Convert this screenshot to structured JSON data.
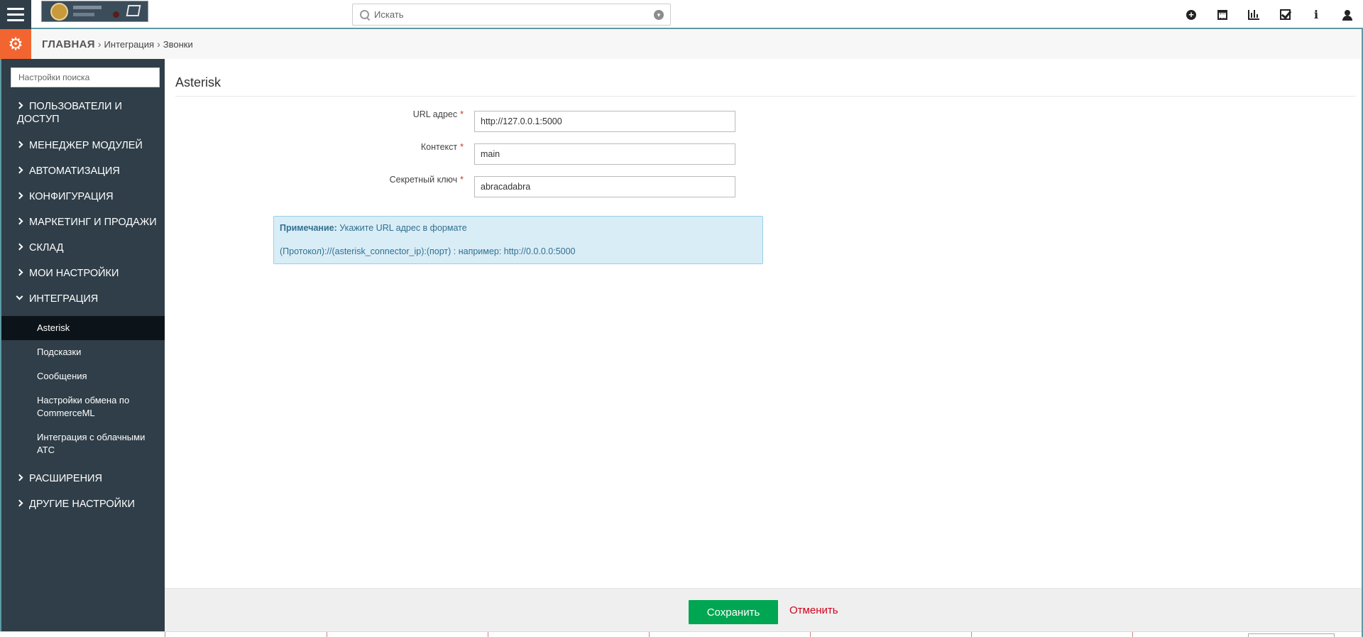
{
  "header": {
    "search_placeholder": "Искать",
    "icons": [
      "plus-circle-icon",
      "calendar-icon",
      "bar-chart-icon",
      "checkbox-icon",
      "info-icon",
      "user-icon"
    ]
  },
  "breadcrumb": {
    "home": "ГЛАВНАЯ",
    "items": [
      "Интеграция",
      "Звонки"
    ]
  },
  "sidebar": {
    "search_placeholder": "Настройки поиска",
    "items": [
      {
        "label": "ПОЛЬЗОВАТЕЛИ И ДОСТУП",
        "expanded": false
      },
      {
        "label": "МЕНЕДЖЕР МОДУЛЕЙ",
        "expanded": false
      },
      {
        "label": "АВТОМАТИЗАЦИЯ",
        "expanded": false
      },
      {
        "label": "КОНФИГУРАЦИЯ",
        "expanded": false
      },
      {
        "label": "МАРКЕТИНГ И ПРОДАЖИ",
        "expanded": false
      },
      {
        "label": "СКЛАД",
        "expanded": false
      },
      {
        "label": "МОИ НАСТРОЙКИ",
        "expanded": false
      },
      {
        "label": "ИНТЕГРАЦИЯ",
        "expanded": true
      },
      {
        "label": "РАСШИРЕНИЯ",
        "expanded": false
      },
      {
        "label": "ДРУГИЕ НАСТРОЙКИ",
        "expanded": false
      }
    ],
    "sub_items": [
      {
        "label": "Asterisk",
        "active": true
      },
      {
        "label": "Подсказки",
        "active": false
      },
      {
        "label": "Сообщения",
        "active": false
      },
      {
        "label": "Настройки обмена по CommerceML",
        "active": false
      },
      {
        "label": "Интеграция с облачными АТС",
        "active": false
      }
    ]
  },
  "main": {
    "title": "Asterisk",
    "fields": [
      {
        "label": "URL адрес",
        "required_mark": "*",
        "value": "http://127.0.0.1:5000"
      },
      {
        "label": "Контекст",
        "required_mark": "*",
        "value": "main"
      },
      {
        "label": "Секретный ключ",
        "required_mark": "*",
        "value": "abracadabra"
      }
    ],
    "note": {
      "prefix": "Примечание:",
      "line1": "Укажите URL адрес в формате",
      "line2": "(Протокол)://(asterisk_connector_ip):(порт) : например: http://0.0.0.0:5000"
    }
  },
  "actions": {
    "save_label": "Сохранить",
    "cancel_label": "Отменить"
  },
  "colors": {
    "sidebar_bg": "#2f3e48",
    "accent_orange": "#f26531",
    "save_green": "#00a651",
    "cancel_red": "#d0021b",
    "note_bg": "#d9edf7"
  }
}
